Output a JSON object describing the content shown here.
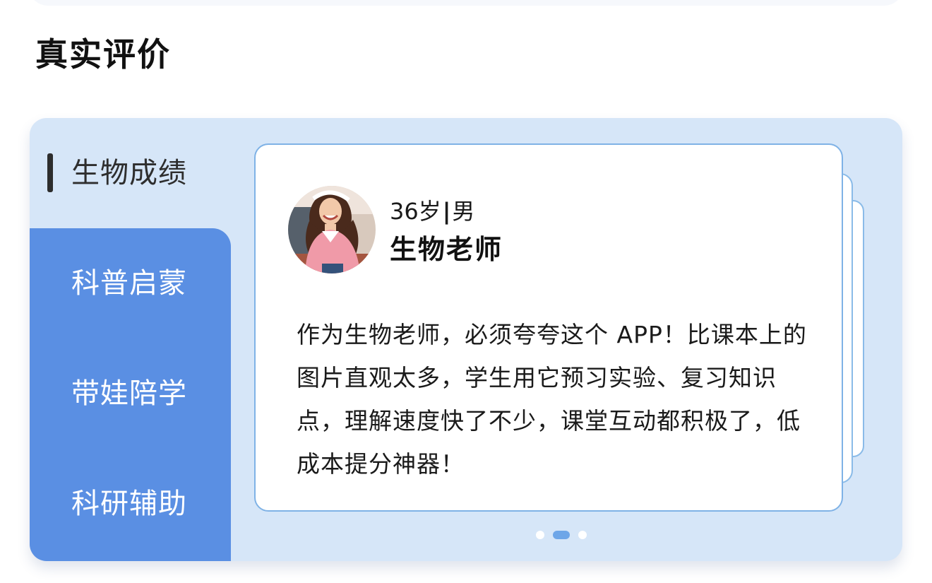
{
  "section": {
    "title": "真实评价"
  },
  "tabs": [
    {
      "label": "生物成绩",
      "active": true
    },
    {
      "label": "科普启蒙",
      "active": false
    },
    {
      "label": "带娃陪学",
      "active": false
    },
    {
      "label": "科研辅助",
      "active": false
    }
  ],
  "review": {
    "age": "36岁",
    "separator": "|",
    "gender": "男",
    "role": "生物老师",
    "text": "作为生物老师，必须夸夸这个 APP！比课本上的图片直观太多，学生用它预习实验、复习知识点，理解速度快了不少，课堂互动都积极了，低成本提分神器！"
  },
  "pagination": {
    "total": 3,
    "current": 2
  },
  "colors": {
    "card_background": "#d6e6f8",
    "tab_group": "#5a8fe3",
    "card_border": "#7fb2e6",
    "active_dot": "#6ea6e8"
  },
  "icons": {
    "avatar": "user-photo-avatar"
  }
}
